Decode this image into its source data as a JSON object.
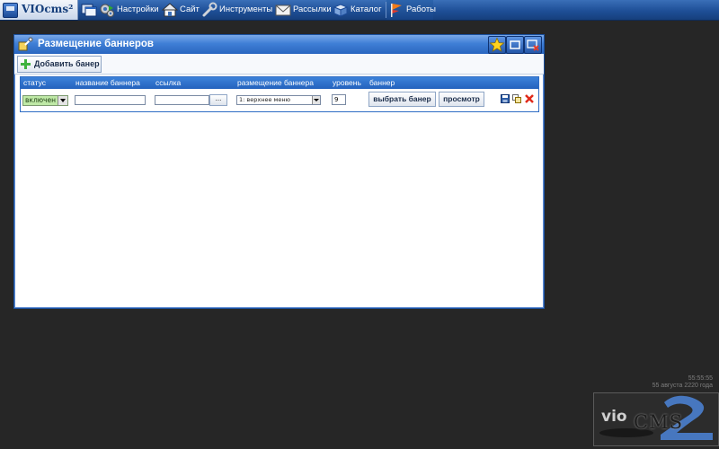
{
  "taskbar": {
    "logo": "VIOcms²",
    "items": [
      {
        "label": "Настройки",
        "icon": "gears-icon"
      },
      {
        "label": "Сайт",
        "icon": "house-icon"
      },
      {
        "label": "Инструменты",
        "icon": "wrench-icon"
      },
      {
        "label": "Рассылки",
        "icon": "envelope-icon"
      },
      {
        "label": "Каталог",
        "icon": "box-icon"
      },
      {
        "label": "Работы",
        "icon": "flag-icon"
      }
    ]
  },
  "window": {
    "title": "Размещение баннеров",
    "add_button": "Добавить банер",
    "columns": [
      "статус",
      "название баннера",
      "ссылка",
      "размещение баннера",
      "уровень",
      "баннер"
    ],
    "row": {
      "status": "включен",
      "name": "",
      "link": "",
      "browse": "...",
      "placement": "1: верхнее меню",
      "level": "9",
      "choose_button": "выбрать банер",
      "preview_button": "просмотр"
    }
  },
  "footer": {
    "time": "55:55:55",
    "date": "55 августа 2220 года"
  },
  "brand": {
    "vio": "vio",
    "cms": "CMS"
  },
  "colors": {
    "taskbar": "#1e4f97",
    "window_title": "#3f7fd6",
    "table_header": "#2e6cc4",
    "status_select": "#bfe9a6",
    "background": "#262626"
  }
}
